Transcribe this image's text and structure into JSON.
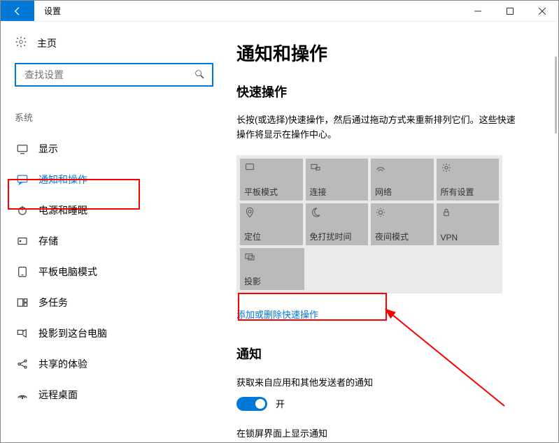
{
  "window": {
    "title": "设置"
  },
  "sidebar": {
    "home": "主页",
    "search_placeholder": "查找设置",
    "group": "系统",
    "items": [
      {
        "label": "显示"
      },
      {
        "label": "通知和操作"
      },
      {
        "label": "电源和睡眠"
      },
      {
        "label": "存储"
      },
      {
        "label": "平板电脑模式"
      },
      {
        "label": "多任务"
      },
      {
        "label": "投影到这台电脑"
      },
      {
        "label": "共享的体验"
      },
      {
        "label": "远程桌面"
      }
    ]
  },
  "main": {
    "heading": "通知和操作",
    "quick_heading": "快速操作",
    "quick_desc": "长按(或选择)快速操作，然后通过拖动方式来重新排列它们。这些快速操作将显示在操作中心。",
    "tiles": [
      {
        "label": "平板模式"
      },
      {
        "label": "连接"
      },
      {
        "label": "网络"
      },
      {
        "label": "所有设置"
      },
      {
        "label": "定位"
      },
      {
        "label": "免打扰时间"
      },
      {
        "label": "夜间模式"
      },
      {
        "label": "VPN"
      },
      {
        "label": "投影"
      }
    ],
    "add_remove_link": "添加或删除快速操作",
    "notif_heading": "通知",
    "notif_line1": "获取来自应用和其他发送者的通知",
    "toggle_on_label": "开",
    "notif_line2": "在锁屏界面上显示通知"
  }
}
